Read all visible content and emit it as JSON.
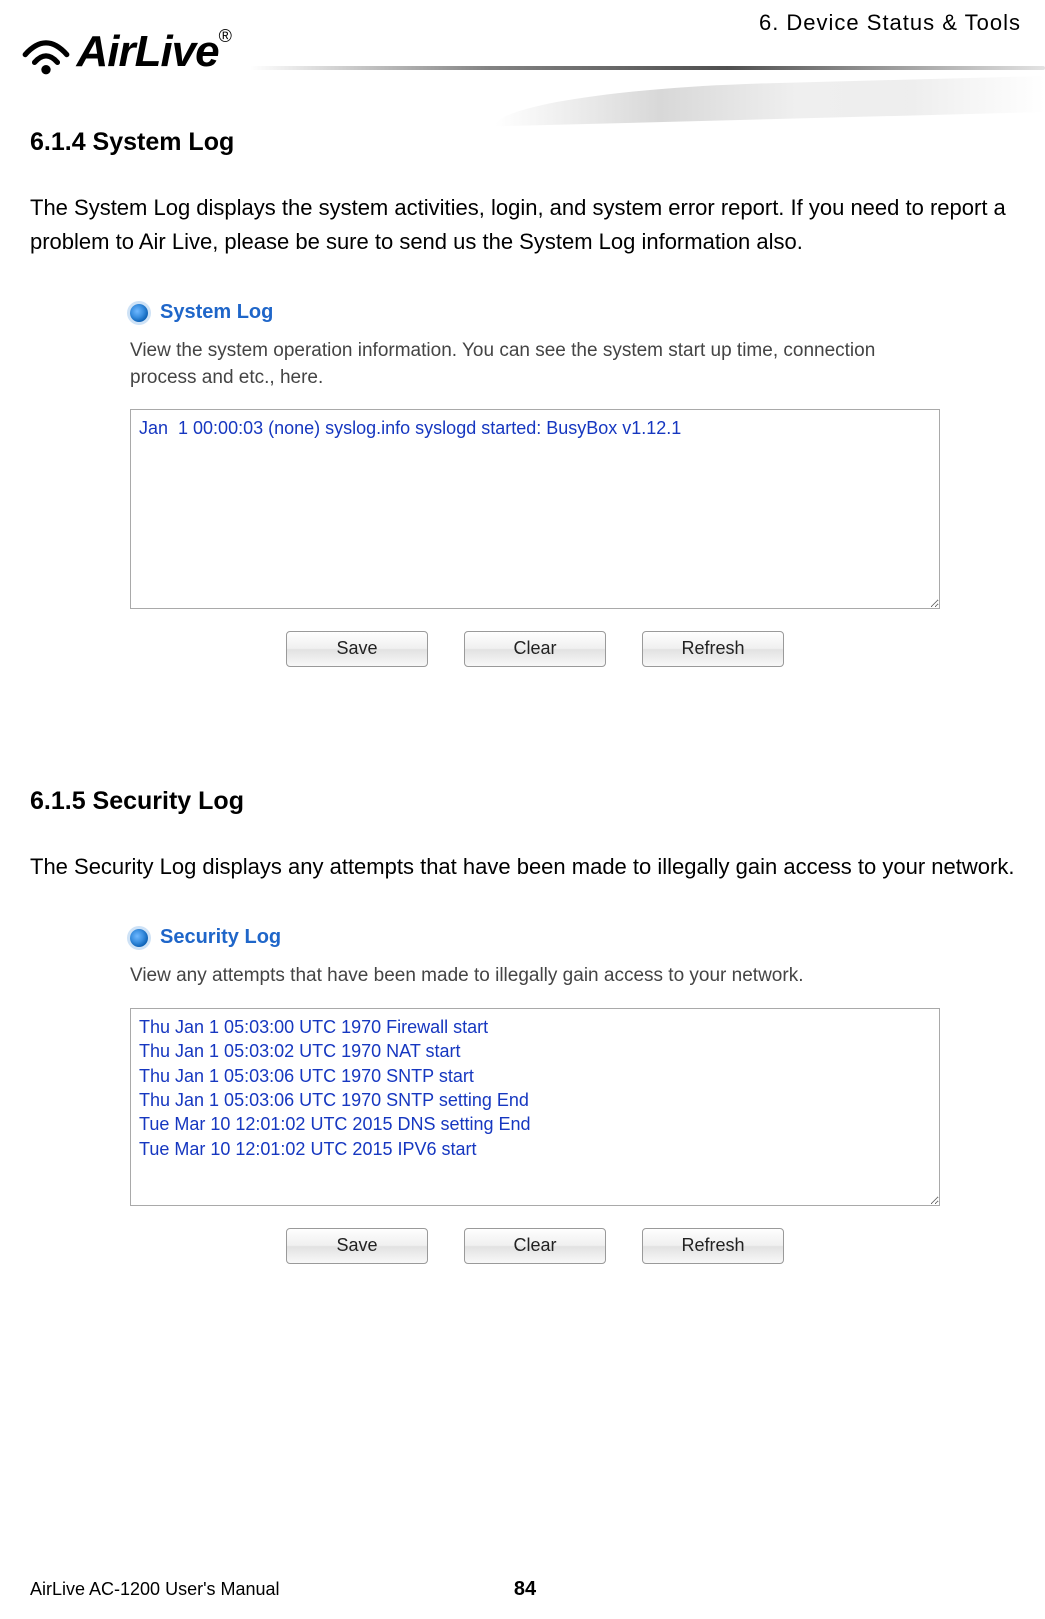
{
  "header": {
    "chapter": "6. Device Status & Tools",
    "logo_text": "AirLive",
    "logo_reg": "®"
  },
  "section_614": {
    "heading": "6.1.4 System Log",
    "body": "The System Log displays the system activities, login, and system error report. If you need to report a problem to Air Live, please be sure to send us the System Log information also.",
    "panel": {
      "title": "System Log",
      "description": "View the system operation information. You can see the system start up time, connection process and etc., here.",
      "log_lines": "Jan  1 00:00:03 (none) syslog.info syslogd started: BusyBox v1.12.1",
      "buttons": {
        "save": "Save",
        "clear": "Clear",
        "refresh": "Refresh"
      }
    }
  },
  "section_615": {
    "heading": "6.1.5 Security Log",
    "body": "The Security Log displays any attempts that have been made to illegally gain access to your network.",
    "panel": {
      "title": "Security Log",
      "description": "View any attempts that have been made to illegally gain access to your network.",
      "log_lines": "Thu Jan 1 05:03:00 UTC 1970 Firewall start\nThu Jan 1 05:03:02 UTC 1970 NAT start\nThu Jan 1 05:03:06 UTC 1970 SNTP start\nThu Jan 1 05:03:06 UTC 1970 SNTP setting End\nTue Mar 10 12:01:02 UTC 2015 DNS setting End\nTue Mar 10 12:01:02 UTC 2015 IPV6 start",
      "buttons": {
        "save": "Save",
        "clear": "Clear",
        "refresh": "Refresh"
      }
    }
  },
  "footer": {
    "manual": "AirLive AC-1200 User's Manual",
    "page_number": "84"
  }
}
